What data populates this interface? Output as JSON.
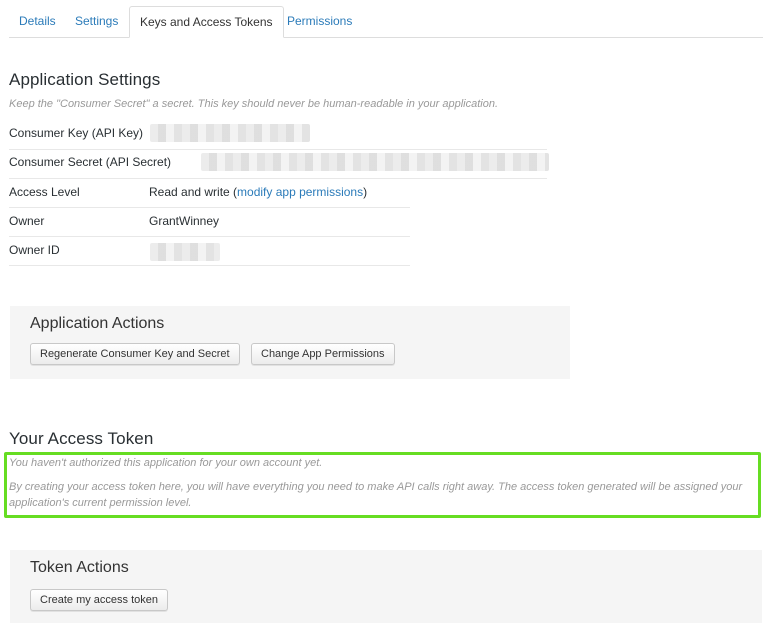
{
  "tabs": [
    {
      "label": "Details"
    },
    {
      "label": "Settings"
    },
    {
      "label": "Keys and Access Tokens"
    },
    {
      "label": "Permissions"
    }
  ],
  "application_settings": {
    "title": "Application Settings",
    "note": "Keep the \"Consumer Secret\" a secret. This key should never be human-readable in your application.",
    "rows": [
      {
        "label": "Consumer Key (API Key)",
        "value": ""
      },
      {
        "label": "Consumer Secret (API Secret)",
        "value": ""
      },
      {
        "label": "Access Level",
        "value_prefix": "Read and write (",
        "link": "modify app permissions",
        "value_suffix": ")"
      },
      {
        "label": "Owner",
        "value": "GrantWinney"
      },
      {
        "label": "Owner ID",
        "value": ""
      }
    ]
  },
  "application_actions": {
    "title": "Application Actions",
    "regenerate_label": "Regenerate Consumer Key and Secret",
    "change_permissions_label": "Change App Permissions"
  },
  "access_token": {
    "title": "Your Access Token",
    "line1": "You haven't authorized this application for your own account yet.",
    "line2": "By creating your access token here, you will have everything you need to make API calls right away. The access token generated will be assigned your application's current permission level.",
    "highlight_color": "#66dd22"
  },
  "token_actions": {
    "title": "Token Actions",
    "create_label": "Create my access token"
  }
}
